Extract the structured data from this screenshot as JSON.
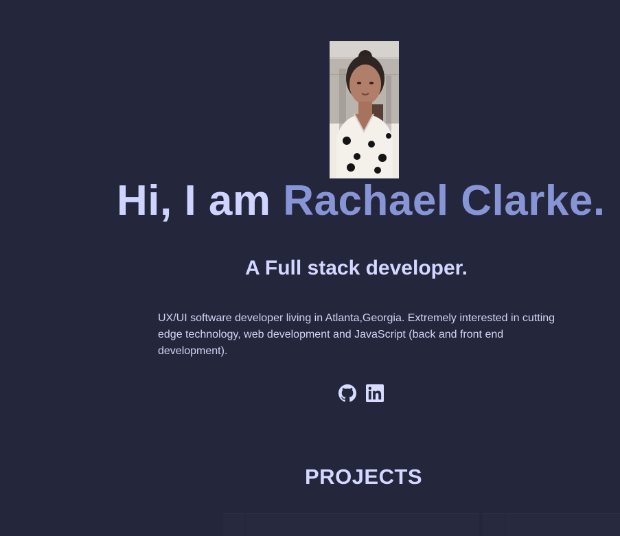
{
  "hero": {
    "greeting": "Hi, I am ",
    "name": "Rachael Clarke.",
    "subtitle": "A Full stack developer.",
    "bio": "UX/UI software developer living in Atlanta,Georgia. Extremely interested in cutting edge technology, web development and JavaScript (back and front end development)."
  },
  "social": {
    "links": [
      {
        "icon": "github-icon"
      },
      {
        "icon": "linkedin-icon"
      }
    ]
  },
  "sections": {
    "projects_title": "PROJECTS"
  },
  "colors": {
    "background": "#24263c",
    "name_accent": "#8795d6",
    "text": "#d4d7ff"
  }
}
